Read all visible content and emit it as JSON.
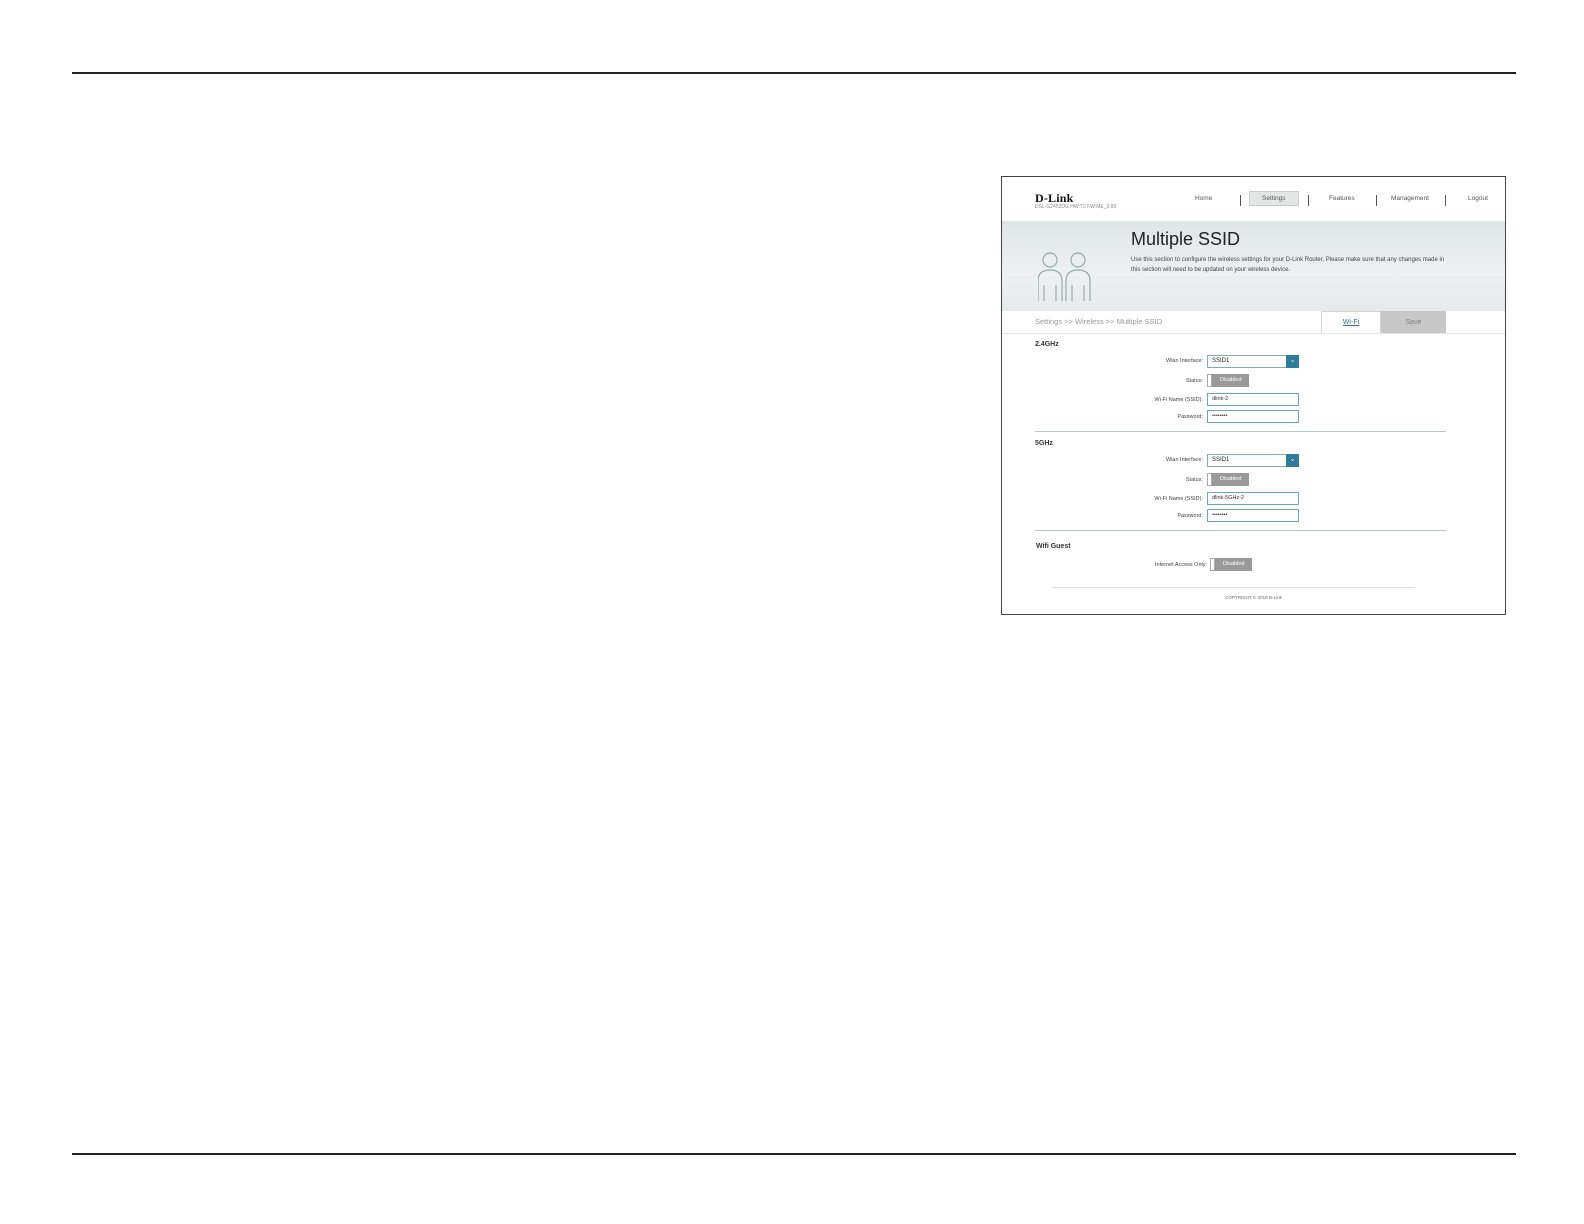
{
  "router": {
    "logo": "D-Link",
    "model_info": "DSL-G2452DG   HW:T2   FW:ME_3.00",
    "nav": {
      "home": "Home",
      "settings": "Settings",
      "features": "Features",
      "management": "Management",
      "logout": "Logout"
    },
    "page_title": "Multiple SSID",
    "page_description": "Use this section to configure the wireless settings for your D-Link Router. Please make sure that any changes made in this section will need to be updated on your wireless device.",
    "breadcrumb": "Settings >> Wireless >> Multiple SSID",
    "wifi_link": "Wi-Fi",
    "save_label": "Save",
    "band_24": {
      "title": "2.4GHz",
      "wlan_label": "Wlan Interface:",
      "wlan_value": "SSID1",
      "status_label": "Status:",
      "status_value": "Disabled",
      "ssid_label": "Wi-Fi Name (SSID):",
      "ssid_value": "dlink-2",
      "password_label": "Password:",
      "password_value": "••••••••"
    },
    "band_5": {
      "title": "5GHz",
      "wlan_label": "Wlan Interface:",
      "wlan_value": "SSID1",
      "status_label": "Status:",
      "status_value": "Disabled",
      "ssid_label": "Wi-Fi Name (SSID):",
      "ssid_value": "dlink-5GHz-2",
      "password_label": "Password:",
      "password_value": "••••••••"
    },
    "guest": {
      "title": "Wifi Guest",
      "internet_label": "Internet Access Only:",
      "internet_value": "Disabled"
    },
    "copyright": "COPYRIGHT © 2018 D-Link"
  },
  "colors": {
    "accent": "#2f7d98",
    "toggle_off": "#9a9a9a"
  }
}
